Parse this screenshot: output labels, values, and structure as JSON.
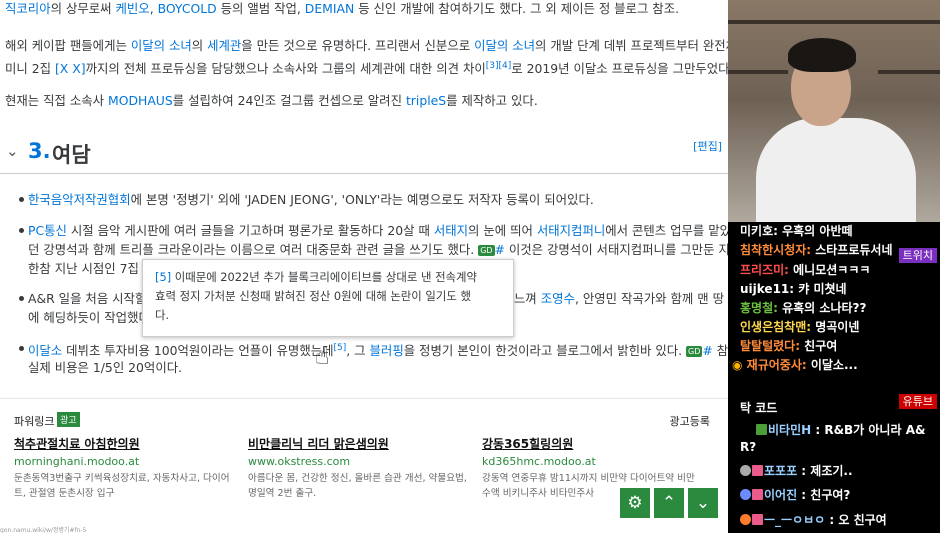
{
  "wiki": {
    "line1": {
      "a": "직코리아",
      "b": "의 상무로써 ",
      "c": "케빈오",
      "d": ", ",
      "e": "BOYCOLD",
      "f": " 등의 앨범 작업, ",
      "g": "DEMIAN",
      "h": " 등 신인 개발에 참여하기도 했다. 그 외 제이든 정 블로그 참조."
    },
    "para2a": {
      "a": "해외 케이팝 팬들에게는 ",
      "b": "이달의 소녀",
      "c": "의 ",
      "d": "세계관",
      "e": "을 만든 것으로 유명하다. 프리랜서 신분으로 ",
      "f": "이달의 소녀",
      "g": "의 개발 단계 데뷔 프로젝트부터 완전체"
    },
    "para2b": {
      "a": "미니 2집 ",
      "b": "[X X]",
      "c": "까지의 전체 프로듀싱을 담당했으나 소속사와 그룹의 세계관에 대한 의견 차이",
      "d": "[3][4]",
      "e": "로 2019년 이달소 프로듀싱을 그만두었다."
    },
    "para3": {
      "a": "현재는 직접 소속사 ",
      "b": "MODHAUS",
      "c": "를 설립하여 24인조 걸그룹 컨셉으로 알려진 ",
      "d": "tripleS",
      "e": "를 제작하고 있다."
    },
    "section": {
      "number": "3.",
      "title": "여담",
      "edit": "[편집]"
    },
    "b1": {
      "a": "한국음악저작권협회",
      "b": "에 본명 '정병기' 외에 'JADEN JEONG', 'ONLY'라는 예명으로도 저작자 등록이 되어있다."
    },
    "b2a": {
      "a": "PC통신",
      "b": " 시절 음악 게시판에 여러 글들을 기고하며 평론가로 활동하다 20살 때 ",
      "c": "서태지",
      "d": "의 눈에 띄어 ",
      "e": "서태지컴퍼니",
      "f": "에서 콘텐츠 업무를 맡았었"
    },
    "b2b": {
      "a": "던 강명석과 함께 트리플 크라운이라는 이름으로 여러 대중문화 관련 글을 쓰기도 했다. ",
      "gd": "GD",
      "hash": "#",
      "b": " 이것은 강명석이 서태지컴퍼니를 그만둔 지도"
    },
    "b2c": {
      "a": "한참 지난 시점인 7집 발"
    },
    "b3a": {
      "a": "A&R 일을 처음 시작할",
      "b": " 느껴 ",
      "c": "조영수",
      "d": ", 안영민 작곡가와 함께 맨 땅"
    },
    "b3b": {
      "a": "에 헤딩하듯이 작업했다"
    },
    "b4a": {
      "a": "이달소",
      "b": " 데뷔초 투자비용 100억원이라는 언플이 유명했는데",
      "c": "[5]",
      "d": ", 그 ",
      "e": "블러핑",
      "f": "을 정병기 본인이 한것이라고 블로그에서 밝힌바 있다. ",
      "gd": "GD",
      "hash": "#",
      "g": " 참고로"
    },
    "b4b": {
      "a": "실제 비용은 1/5인 20억이다."
    },
    "tooltip": {
      "fn": "[5]",
      "l1": " 이때문에 2022년 추가 블록크리에이티브를 상대로 낸 전속계약",
      "l2": "효력 정지 가처분 신청때 밝혀진 정산 0원에 대해 논란이 일기도 했",
      "l3": "다."
    },
    "ads": {
      "label": "파워링크",
      "badge": "광고",
      "register": "광고등록",
      "items": [
        {
          "title": "척추관절치료 아침한의원",
          "url": "morninghani.modoo.at",
          "desc": "둔촌동역3번출구 키썩육성장치료, 자동차사고, 다이어\n트, 관절염 둔촌시장 입구"
        },
        {
          "title": "비만클리닉 리더 맑은샘의원",
          "url": "www.okstress.com",
          "desc": "아름다운 몸, 건강한 정신, 올바른 습관 개선, 약물요법,\n명일역 2번 출구."
        },
        {
          "title": "강동365힐링의원",
          "url": "kd365hmc.modoo.at",
          "desc": "강동역 연중무휴 밤11시까지 비만약 다이어트약 비만\n수액 비키니주사 비타민주사"
        }
      ]
    },
    "status": "gon.namu.wiki/w/정병기#fn-5"
  },
  "chat": {
    "twitch_tag": "트위치",
    "youtube_tag": "유튜브",
    "twitch": [
      {
        "name": "미키호:",
        "msg": " 우혹의 아반떼",
        "color": "#ffffff"
      },
      {
        "name": "침착한시청자:",
        "msg": " 스타프로듀서네",
        "color": "#ff8c3a"
      },
      {
        "name": "프리즈미:",
        "msg": " 에니모션ㅋㅋㅋ",
        "color": "#ff4d4d"
      },
      {
        "name": "uijke11:",
        "msg": " 캬 미쳣네",
        "color": "#ffffff"
      },
      {
        "name": "홍명철:",
        "msg": " 유혹의 소나타??",
        "color": "#6dbf3f"
      },
      {
        "name": "인생은침착맨:",
        "msg": " 명곡이넨",
        "color": "#ffd84d"
      },
      {
        "name": "탈탈털렸다:",
        "msg": " 친구여",
        "color": "#ff8c3a"
      },
      {
        "name": "재규어중사:",
        "msg": " 이달소...",
        "color": "#ff8c3a"
      }
    ],
    "youtube_header": "탁 코드",
    "youtube": [
      {
        "name": "비타민H",
        "msg": " : R&B가 아니라 A&",
        "msg2": "R?",
        "color": "#9ad0ff"
      },
      {
        "name": "포포포",
        "msg": " : 제조기..",
        "color": "#9ad0ff"
      },
      {
        "name": "이어진",
        "msg": " : 친구여?",
        "color": "#9ad0ff"
      },
      {
        "name": "ㅡ_ㅡㅇㅂㅇ",
        "msg": " : 오 친구여",
        "color": "#9ad0ff"
      }
    ]
  },
  "buttons": {
    "settings_icon": "gear-icon",
    "up_icon": "chevron-up-icon",
    "down_icon": "chevron-down-icon"
  },
  "colors": {
    "link": "#0275d8",
    "green": "#2b8a3e",
    "twitch_purple": "#7b2fbe",
    "youtube_red": "#cc0000"
  }
}
